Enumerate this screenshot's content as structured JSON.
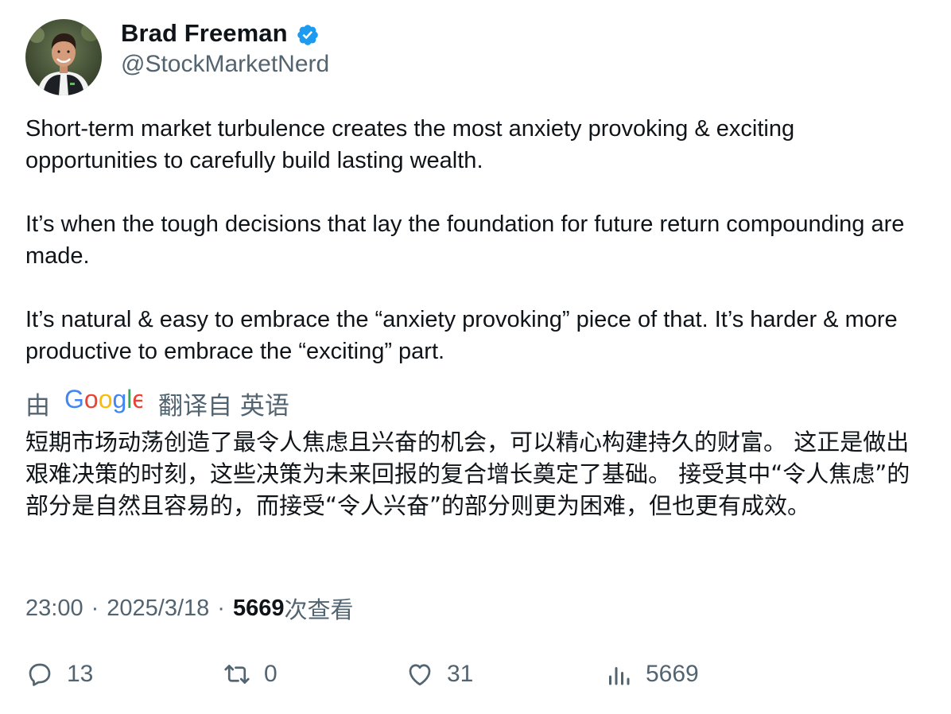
{
  "author": {
    "display_name": "Brad Freeman",
    "handle": "@StockMarketNerd",
    "verified": true,
    "verified_color": "#1d9bf0"
  },
  "tweet": {
    "paragraphs": [
      "Short-term market turbulence creates the most anxiety provoking & exciting opportunities to carefully build lasting wealth.",
      "It’s when the tough decisions that lay the foundation for future return compounding are made.",
      "It’s natural & easy to embrace the “anxiety provoking” piece of that. It’s harder & more productive to embrace the “exciting” part."
    ]
  },
  "translation": {
    "by_label": "由",
    "provider": "Google",
    "from_label": "翻译自 英语",
    "text": "短期市场动荡创造了最令人焦虑且兴奋的机会，可以精心构建持久的财富。 这正是做出艰难决策的时刻，这些决策为未来回报的复合增长奠定了基础。 接受其中“令人焦虑”的部分是自然且容易的，而接受“令人兴奋”的部分则更为困难，但也更有成效。"
  },
  "meta": {
    "time": "23:00",
    "separator": "·",
    "date": "2025/3/18",
    "views_count": "5669",
    "views_label": "次查看"
  },
  "actions": {
    "replies": "13",
    "retweets": "0",
    "likes": "31",
    "views": "5669"
  },
  "icons": {
    "reply": "reply-bubble-icon",
    "retweet": "retweet-arrows-icon",
    "like": "heart-icon",
    "views": "bar-chart-icon",
    "verified": "verified-badge-icon"
  },
  "colors": {
    "text": "#0f1419",
    "secondary": "#536471"
  }
}
